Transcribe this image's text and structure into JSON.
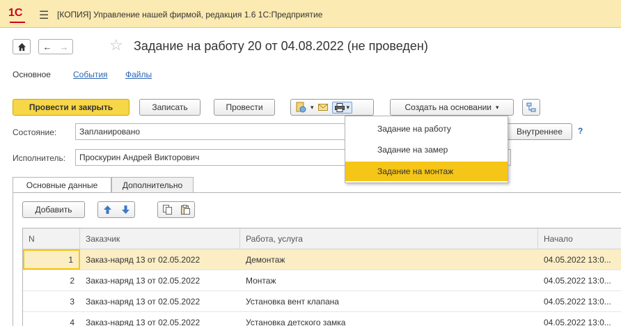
{
  "window": {
    "logo": "1С",
    "title": "[КОПИЯ] Управление нашей фирмой, редакция 1.6 1С:Предприятие"
  },
  "nav": {
    "home_icon": "home-icon",
    "back": "←",
    "forward": "→",
    "star": "☆"
  },
  "document": {
    "title": "Задание на работу 20 от 04.08.2022 (не проведен)"
  },
  "tabs": [
    {
      "label": "Основное"
    },
    {
      "label": "События"
    },
    {
      "label": "Файлы"
    }
  ],
  "toolbar": {
    "post_close": "Провести и закрыть",
    "save": "Записать",
    "post": "Провести",
    "create_based": "Создать на основании",
    "dropdown_arrow": "▾"
  },
  "form": {
    "state_label": "Состояние:",
    "state_value": "Запланировано",
    "type_value": "Внутреннее",
    "help": "?",
    "executor_label": "Исполнитель:",
    "executor_value": "Проскурин Андрей Викторович"
  },
  "print_menu": {
    "items": [
      {
        "label": "Задание на работу"
      },
      {
        "label": "Задание на замер"
      },
      {
        "label": "Задание на монтаж"
      }
    ],
    "selected_index": 2
  },
  "subtabs": [
    {
      "label": "Основные данные"
    },
    {
      "label": "Дополнительно"
    }
  ],
  "table_toolbar": {
    "add": "Добавить"
  },
  "table": {
    "columns": [
      "N",
      "Заказчик",
      "Работа, услуга",
      "Начало"
    ],
    "rows": [
      {
        "n": "1",
        "customer": "Заказ-наряд 13 от 02.05.2022",
        "work": "Демонтаж",
        "start": "04.05.2022 13:0..."
      },
      {
        "n": "2",
        "customer": "Заказ-наряд 13 от 02.05.2022",
        "work": "Монтаж",
        "start": "04.05.2022 13:0..."
      },
      {
        "n": "3",
        "customer": "Заказ-наряд 13 от 02.05.2022",
        "work": "Установка вент клапана",
        "start": "04.05.2022 13:0..."
      },
      {
        "n": "4",
        "customer": "Заказ-наряд 13 от 02.05.2022",
        "work": "Установка детского замка",
        "start": "04.05.2022 13:0..."
      }
    ]
  },
  "colors": {
    "accent": "#f5c518",
    "titlebar": "#fbeab1",
    "link": "#2a65b4"
  }
}
